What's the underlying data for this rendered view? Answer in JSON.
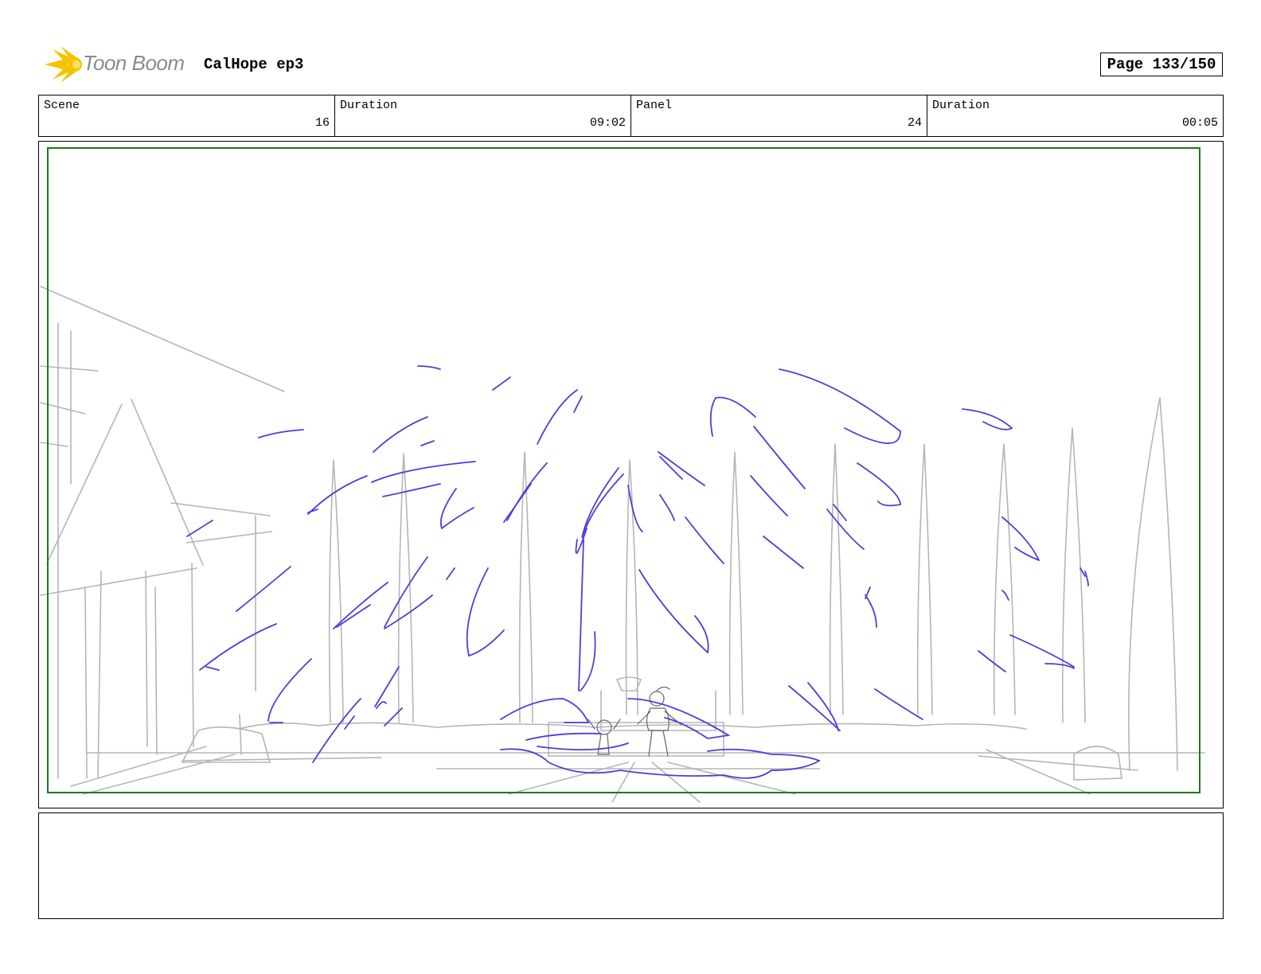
{
  "header": {
    "brand_name": "Toon Boom",
    "project_title": "CalHope ep3",
    "page_label": "Page 133/150"
  },
  "info": {
    "scene_label": "Scene",
    "scene_value": "16",
    "scene_duration_label": "Duration",
    "scene_duration_value": "09:02",
    "panel_label": "Panel",
    "panel_value": "24",
    "panel_duration_label": "Duration",
    "panel_duration_value": "00:05"
  },
  "colors": {
    "safe_frame": "#1a7a1a",
    "fx_sketch": "#4b3fd9",
    "bg_sketch": "#b0b0b0",
    "logo_yellow": "#f5c400"
  }
}
